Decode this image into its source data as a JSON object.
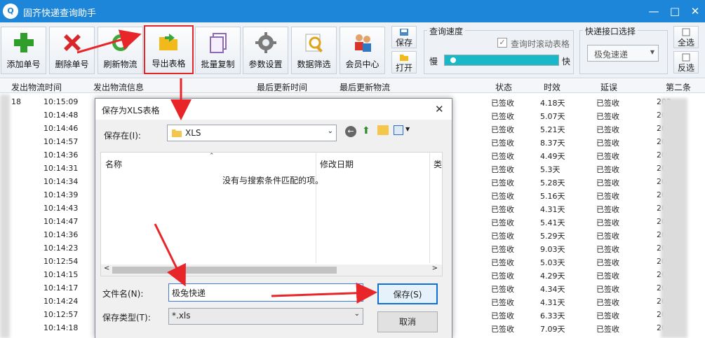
{
  "window": {
    "title": "固齐快递查询助手",
    "icon_text": "Q"
  },
  "toolbar": {
    "buttons": [
      {
        "label": "添加单号"
      },
      {
        "label": "删除单号"
      },
      {
        "label": "刷新物流"
      },
      {
        "label": "导出表格"
      },
      {
        "label": "批量复制"
      },
      {
        "label": "参数设置"
      },
      {
        "label": "数据筛选"
      },
      {
        "label": "会员中心"
      }
    ],
    "save_label": "保存",
    "open_label": "打开",
    "speed": {
      "title": "查询速度",
      "slow": "慢",
      "fast": "快",
      "scroll_label": "查询时滚动表格",
      "scroll_checked": true
    },
    "api": {
      "title": "快递接口选择",
      "selected": "极兔速递"
    },
    "select_all": "全选",
    "invert_select": "反选"
  },
  "table": {
    "columns": [
      "发出物流时间",
      "发出物流信息",
      "最后更新时间",
      "最后更新物流",
      "状态",
      "时效",
      "延误",
      "第二条"
    ],
    "rows": [
      {
        "time": "10:15:09",
        "status": "已签收",
        "days": "4.18天",
        "delay": "已签收"
      },
      {
        "time": "10:14:48",
        "status": "已签收",
        "days": "5.07天",
        "delay": "已签收"
      },
      {
        "time": "10:14:46",
        "status": "已签收",
        "days": "5.21天",
        "delay": "已签收"
      },
      {
        "time": "10:14:57",
        "status": "已签收",
        "days": "8.37天",
        "delay": "已签收"
      },
      {
        "time": "10:14:36",
        "status": "已签收",
        "days": "4.49天",
        "delay": "已签收"
      },
      {
        "time": "10:14:31",
        "status": "已签收",
        "days": "5.3天",
        "delay": "已签收"
      },
      {
        "time": "10:14:34",
        "status": "已签收",
        "days": "5.28天",
        "delay": "已签收"
      },
      {
        "time": "10:14:39",
        "status": "已签收",
        "days": "5.16天",
        "delay": "已签收"
      },
      {
        "time": "10:14:43",
        "status": "已签收",
        "days": "4.31天",
        "delay": "已签收"
      },
      {
        "time": "10:14:47",
        "status": "已签收",
        "days": "5.41天",
        "delay": "已签收"
      },
      {
        "time": "10:14:36",
        "status": "已签收",
        "days": "5.29天",
        "delay": "已签收"
      },
      {
        "time": "10:14:23",
        "status": "已签收",
        "days": "9.03天",
        "delay": "已签收"
      },
      {
        "time": "10:12:54",
        "status": "已签收",
        "days": "5.03天",
        "delay": "已签收"
      },
      {
        "time": "10:14:15",
        "status": "已签收",
        "days": "4.29天",
        "delay": "已签收"
      },
      {
        "time": "10:14:17",
        "status": "已签收",
        "days": "4.34天",
        "delay": "已签收"
      },
      {
        "time": "10:14:24",
        "status": "已签收",
        "days": "4.31天",
        "delay": "已签收"
      },
      {
        "time": "10:12:57",
        "status": "已签收",
        "days": "6.33天",
        "delay": "已签收"
      },
      {
        "time": "10:14:18",
        "status": "已签收",
        "days": "7.09天",
        "delay": "已签收"
      }
    ],
    "row_prefix": "18",
    "partial_year": "202"
  },
  "dialog": {
    "title": "保存为XLS表格",
    "save_in_label": "保存在(I):",
    "save_in_value": "XLS",
    "col_name": "名称",
    "col_modified": "修改日期",
    "col_type": "类",
    "empty_msg": "没有与搜索条件匹配的项。",
    "filename_label": "文件名(N):",
    "filename_value": "极兔快递",
    "filetype_label": "保存类型(T):",
    "filetype_value": "*.xls",
    "save_button": "保存(S)",
    "cancel_button": "取消"
  },
  "colors": {
    "title_bar": "#1e86d8",
    "highlight": "#e8262a",
    "progress": "#19b8c8"
  }
}
